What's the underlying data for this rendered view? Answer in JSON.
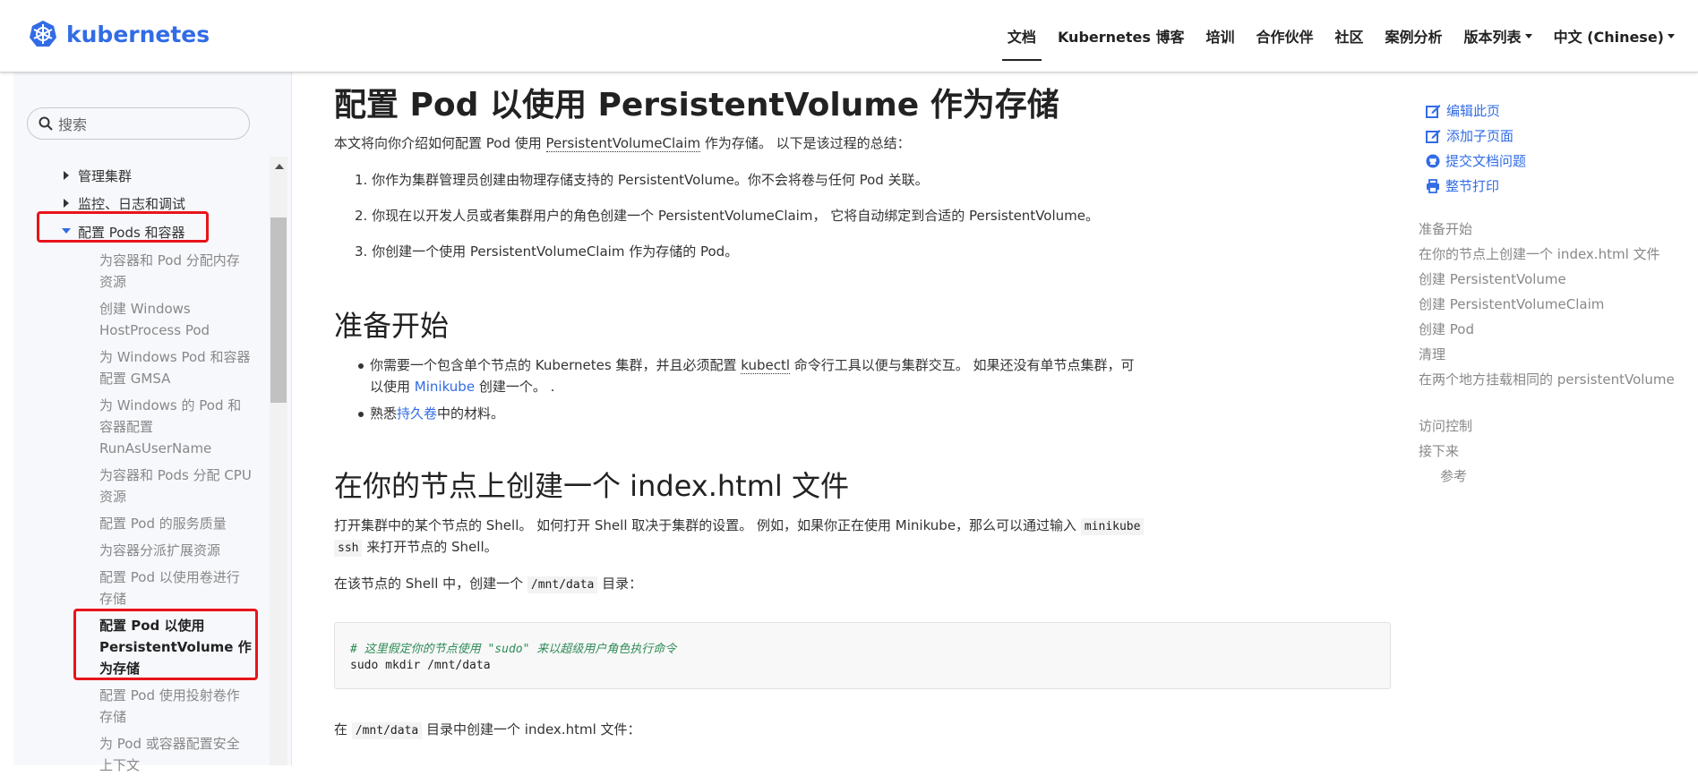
{
  "header": {
    "logo_text": "kubernetes",
    "nav": [
      {
        "label": "文档",
        "active": true
      },
      {
        "label": "Kubernetes 博客"
      },
      {
        "label": "培训"
      },
      {
        "label": "合作伙伴"
      },
      {
        "label": "社区"
      },
      {
        "label": "案例分析"
      },
      {
        "label": "版本列表",
        "dropdown": true
      },
      {
        "label": "中文 (Chinese)",
        "dropdown": true
      }
    ]
  },
  "sidebar": {
    "search_placeholder": "搜索",
    "sections": [
      "管理集群",
      "监控、日志和调试",
      "配置 Pods 和容器"
    ],
    "items": [
      "为容器和 Pod 分配内存资源",
      "创建 Windows HostProcess Pod",
      "为 Windows Pod 和容器配置 GMSA",
      "为 Windows 的 Pod 和容器配置 RunAsUserName",
      "为容器和 Pods 分配 CPU 资源",
      "配置 Pod 的服务质量",
      "为容器分派扩展资源",
      "配置 Pod 以使用卷进行存储",
      "配置 Pod 以使用 PersistentVolume 作为存储",
      "配置 Pod 使用投射卷作存储",
      "为 Pod 或容器配置安全上下文"
    ]
  },
  "main": {
    "title": "配置 Pod 以使用 PersistentVolume 作为存储",
    "intro_a": "本文将向你介绍如何配置 Pod 使用 ",
    "intro_link": "PersistentVolumeClaim",
    "intro_b": " 作为存储。 以下是该过程的总结：",
    "steps": [
      "1. 你作为集群管理员创建由物理存储支持的 PersistentVolume。你不会将卷与任何 Pod 关联。",
      "2. 你现在以开发人员或者集群用户的角色创建一个 PersistentVolumeClaim， 它将自动绑定到合适的 PersistentVolume。",
      "3. 你创建一个使用 PersistentVolumeClaim 作为存储的 Pod。"
    ],
    "h2_prep": "准备开始",
    "prep_1a": "你需要一个包含单个节点的 Kubernetes 集群，并且必须配置 ",
    "prep_1_kubectl": "kubectl",
    "prep_1b": " 命令行工具以便与集群交互。 如果还没有单节点集群，可",
    "prep_1c": "以使用 ",
    "prep_1_minikube": "Minikube",
    "prep_1d": " 创建一个。 .",
    "prep_2a": "熟悉",
    "prep_2_link": "持久卷",
    "prep_2b": "中的材料。",
    "h2_index": "在你的节点上创建一个 index.html 文件",
    "shell_a": "打开集群中的某个节点的 Shell。 如何打开 Shell 取决于集群的设置。 例如，如果你正在使用 Minikube，那么可以通过输入 ",
    "shell_code1": "minikube",
    "shell_code2": "ssh",
    "shell_b": " 来打开节点的 Shell。",
    "mkdir_a": "在该节点的 Shell 中，创建一个 ",
    "mkdir_code": "/mnt/data",
    "mkdir_b": " 目录：",
    "code_comment": "# 这里假定你的节点使用 \"sudo\" 来以超级用户角色执行命令",
    "code_cmd": "sudo mkdir /mnt/data",
    "last_a": "在 ",
    "last_code": "/mnt/data",
    "last_b": " 目录中创建一个 index.html 文件："
  },
  "right": {
    "actions": [
      "编辑此页",
      "添加子页面",
      "提交文档问题",
      "整节打印"
    ],
    "toc": [
      "准备开始",
      "在你的节点上创建一个 index.html 文件",
      "创建 PersistentVolume",
      "创建 PersistentVolumeClaim",
      "创建 Pod",
      "清理",
      "在两个地方挂载相同的 persistentVolume",
      "访问控制",
      "接下来",
      "参考"
    ]
  },
  "colors": {
    "accent": "#326ce5",
    "highlight": "#e8141b"
  }
}
